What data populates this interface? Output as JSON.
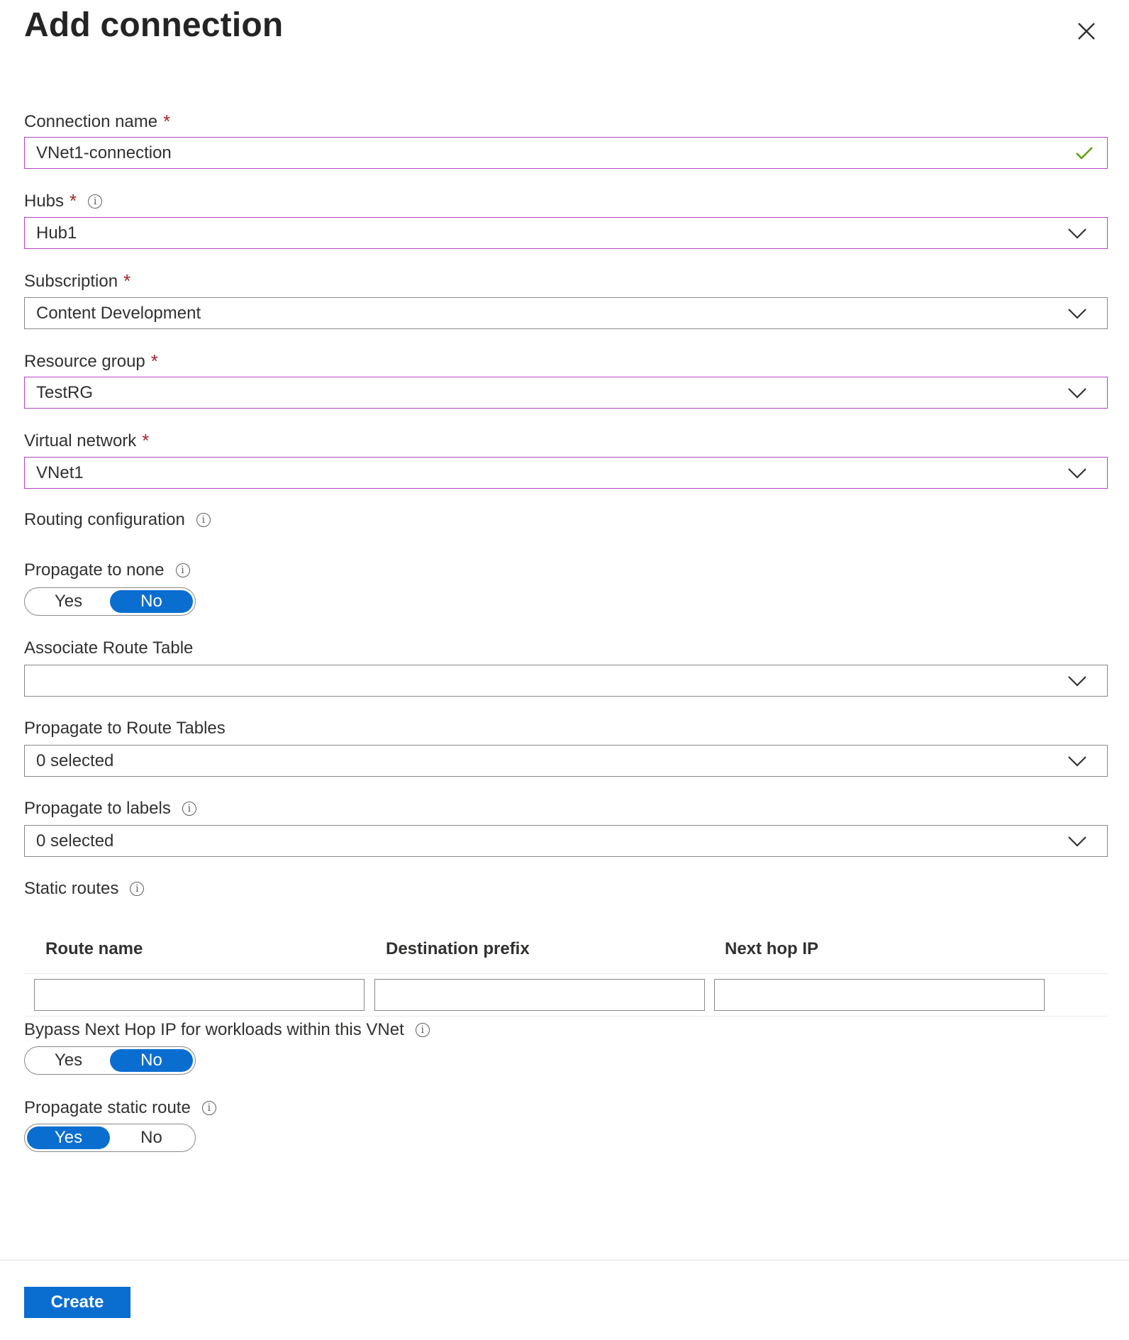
{
  "title": "Add connection",
  "fields": {
    "connection_name": {
      "label": "Connection name",
      "required": "*",
      "value": "VNet1-connection"
    },
    "hubs": {
      "label": "Hubs",
      "required": "*",
      "value": "Hub1"
    },
    "subscription": {
      "label": "Subscription",
      "required": "*",
      "value": "Content Development"
    },
    "resource_group": {
      "label": "Resource group",
      "required": "*",
      "value": "TestRG"
    },
    "virtual_network": {
      "label": "Virtual network",
      "required": "*",
      "value": "VNet1"
    }
  },
  "routing": {
    "section_label": "Routing configuration",
    "propagate_none": {
      "label": "Propagate to none",
      "yes": "Yes",
      "no": "No",
      "selected": "No"
    },
    "associate_route_table": {
      "label": "Associate Route Table",
      "value": ""
    },
    "propagate_route_tables": {
      "label": "Propagate to Route Tables",
      "value": "0 selected"
    },
    "propagate_labels": {
      "label": "Propagate to labels",
      "value": "0 selected"
    }
  },
  "static_routes": {
    "label": "Static routes",
    "columns": [
      "Route name",
      "Destination prefix",
      "Next hop IP"
    ],
    "row": [
      "",
      "",
      ""
    ],
    "bypass": {
      "label": "Bypass Next Hop IP for workloads within this VNet",
      "yes": "Yes",
      "no": "No",
      "selected": "No"
    },
    "propagate_static": {
      "label": "Propagate static route",
      "yes": "Yes",
      "no": "No",
      "selected": "Yes"
    }
  },
  "footer": {
    "create_label": "Create"
  },
  "icons": {
    "close": "close-icon",
    "info": "info-icon",
    "chevron": "chevron-down-icon",
    "check": "checkmark-icon"
  },
  "colors": {
    "accent": "#0a6ed1",
    "focus_border": "#b146c2",
    "required": "#a4262c",
    "valid": "#57a300"
  }
}
